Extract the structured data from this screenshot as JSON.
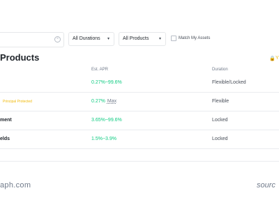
{
  "filters": {
    "search_clear_icon": "close-circle-icon",
    "durations_label": "All Durations",
    "products_label": "All Products",
    "match_assets_label": "Match My Assets"
  },
  "header": {
    "title": "Products",
    "right_icon": "lock-icon",
    "right_text": "Y"
  },
  "table": {
    "columns": {
      "apr": "Est. APR",
      "duration": "Duration"
    },
    "rows": [
      {
        "name": "",
        "tag": "",
        "apr": "0.27%~99.6%",
        "apr_suffix": "",
        "duration": "Flexible/Locked"
      },
      {
        "name": "",
        "tag": "Principal Protected",
        "apr": "0.27%",
        "apr_suffix": "Max",
        "duration": "Flexible"
      },
      {
        "name": "ment",
        "tag": "",
        "apr": "3.65%~99.6%",
        "apr_suffix": "",
        "duration": "Locked"
      },
      {
        "name": "elds",
        "tag": "",
        "apr": "1.5%~3.9%",
        "apr_suffix": "",
        "duration": "Locked"
      }
    ]
  },
  "footer": {
    "left_text": "aph.com",
    "right_text": "sourc"
  },
  "colors": {
    "accent_green": "#0ecb81",
    "accent_yellow": "#f0b90b"
  }
}
